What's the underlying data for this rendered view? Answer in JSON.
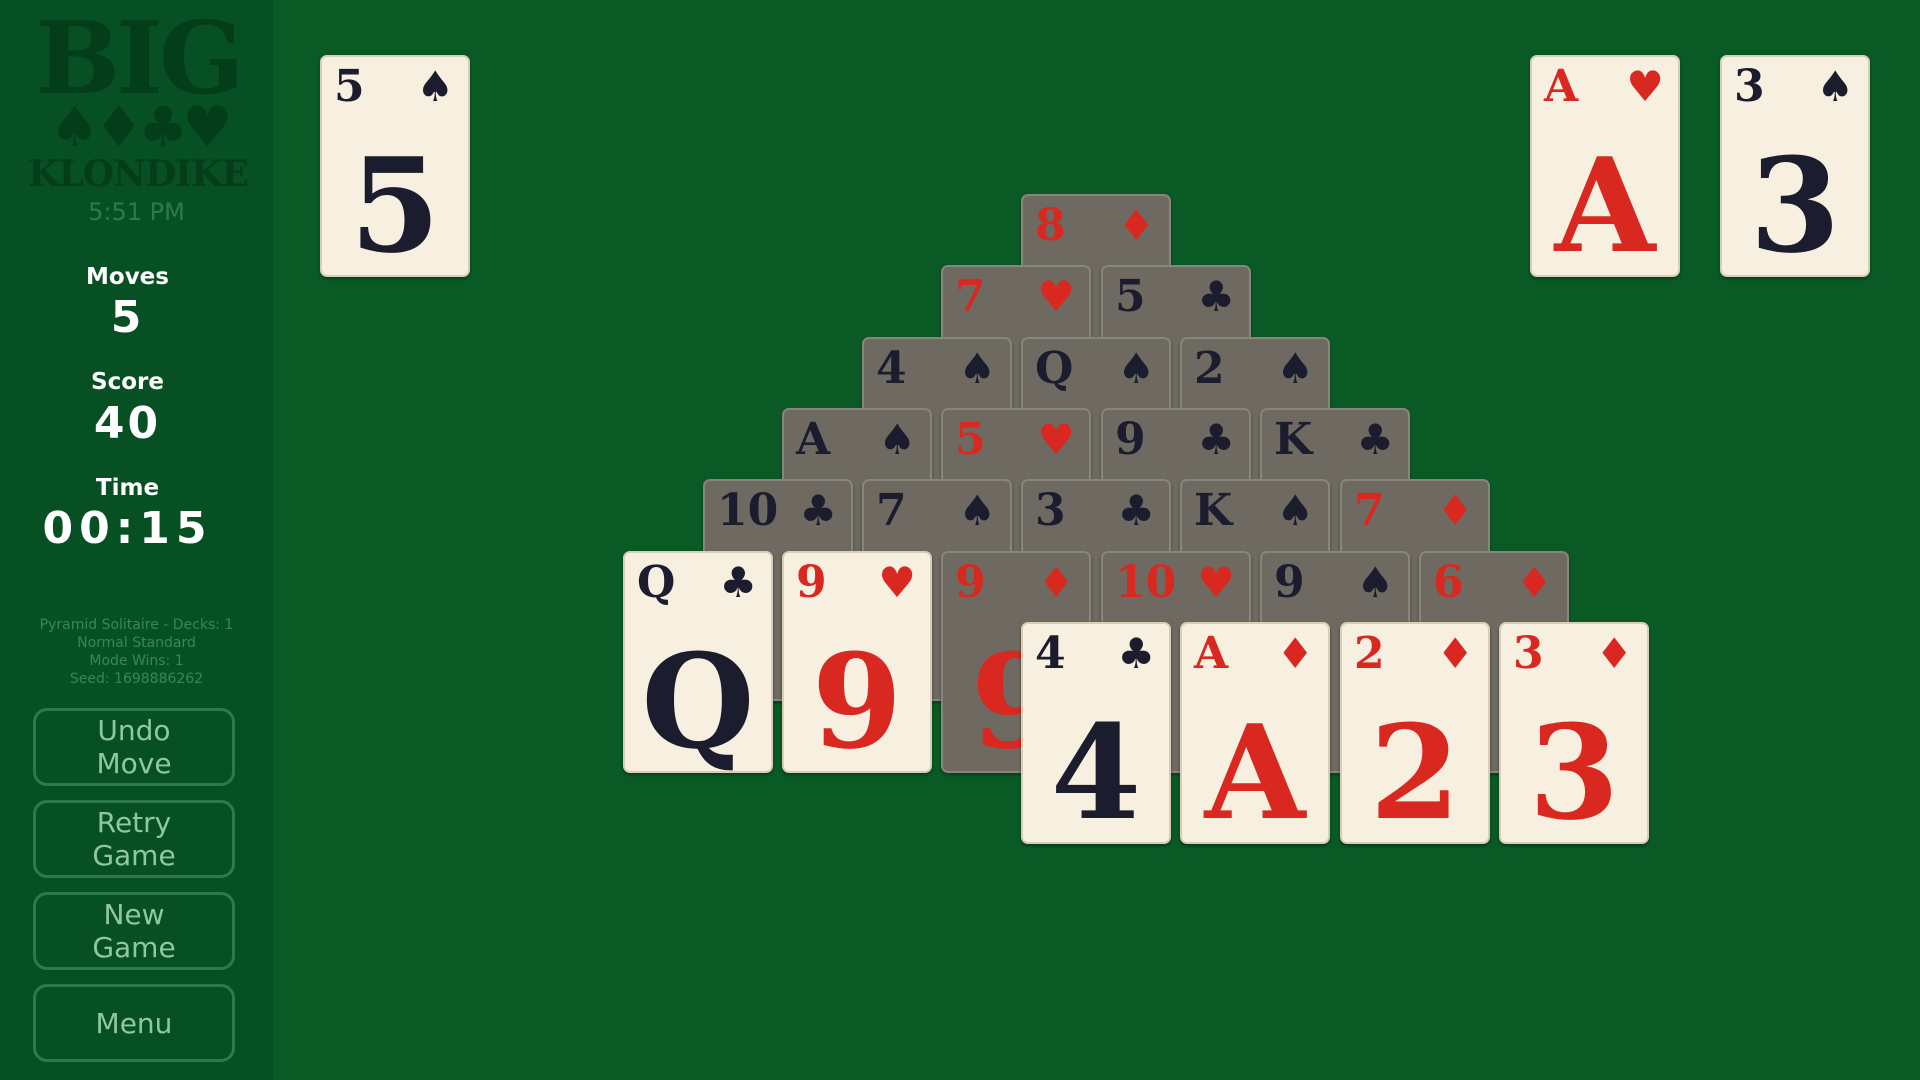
{
  "sidebar": {
    "logo_big": "BIG",
    "logo_suits": "♠♦♣♥",
    "logo_sub": "KLONDIKE",
    "clock": "5:51 PM",
    "moves_label": "Moves",
    "moves_value": "5",
    "score_label": "Score",
    "score_value": "40",
    "time_label": "Time",
    "time_value": "00:15",
    "info": {
      "line1": "Pyramid Solitaire - Decks: 1",
      "line2": "Normal Standard",
      "line3": "Mode Wins: 1",
      "line4": "Seed: 1698886262"
    },
    "buttons": {
      "undo": "Undo\nMove",
      "retry": "Retry\nGame",
      "new_game": "New\nGame",
      "menu": "Menu"
    }
  },
  "waste_pile": {
    "rank": "5",
    "suit": "♠",
    "color": "black"
  },
  "foundation": [
    {
      "rank": "A",
      "suit": "♥",
      "color": "red"
    },
    {
      "rank": "3",
      "suit": "♠",
      "color": "black"
    }
  ],
  "pyramid_covered": [
    {
      "rank": "8",
      "suit": "♦",
      "color": "red"
    },
    {
      "rank": "7",
      "suit": "♥",
      "color": "red"
    },
    {
      "rank": "5",
      "suit": "♣",
      "color": "black"
    },
    {
      "rank": "4",
      "suit": "♠",
      "color": "black"
    },
    {
      "rank": "Q",
      "suit": "♠",
      "color": "black"
    },
    {
      "rank": "2",
      "suit": "♠",
      "color": "black"
    },
    {
      "rank": "A",
      "suit": "♠",
      "color": "black"
    },
    {
      "rank": "5",
      "suit": "♥",
      "color": "red"
    },
    {
      "rank": "9",
      "suit": "♣",
      "color": "black"
    },
    {
      "rank": "K",
      "suit": "♣",
      "color": "black"
    },
    {
      "rank": "10",
      "suit": "♣",
      "color": "black"
    },
    {
      "rank": "7",
      "suit": "♠",
      "color": "black"
    },
    {
      "rank": "3",
      "suit": "♣",
      "color": "black"
    },
    {
      "rank": "K",
      "suit": "♠",
      "color": "black"
    },
    {
      "rank": "7",
      "suit": "♦",
      "color": "red"
    },
    {
      "rank": "9",
      "suit": "♦",
      "color": "red"
    },
    {
      "rank": "10",
      "suit": "♥",
      "color": "red"
    },
    {
      "rank": "9",
      "suit": "♠",
      "color": "black"
    },
    {
      "rank": "6",
      "suit": "♦",
      "color": "red"
    }
  ],
  "pyramid_open": [
    {
      "rank": "Q",
      "suit": "♣",
      "color": "black"
    },
    {
      "rank": "9",
      "suit": "♥",
      "color": "red"
    },
    {
      "rank": "4",
      "suit": "♣",
      "color": "black"
    },
    {
      "rank": "A",
      "suit": "♦",
      "color": "red"
    },
    {
      "rank": "2",
      "suit": "♦",
      "color": "red"
    },
    {
      "rank": "3",
      "suit": "♦",
      "color": "red"
    }
  ]
}
